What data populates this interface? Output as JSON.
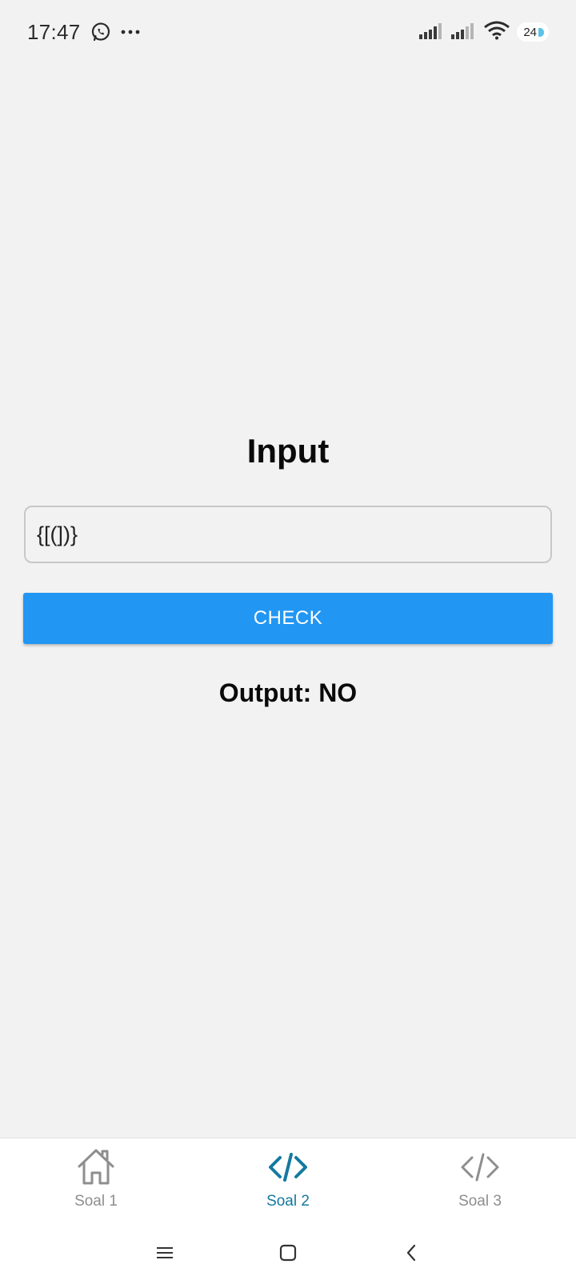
{
  "status_bar": {
    "time": "17:47",
    "battery_level": "24",
    "icons": [
      "whatsapp-icon",
      "more-dots-icon",
      "signal-icon",
      "signal-icon",
      "wifi-icon",
      "battery-icon"
    ]
  },
  "main": {
    "title": "Input",
    "input_value": "{[(])}",
    "check_label": "CHECK",
    "output_text": "Output: NO"
  },
  "tabs": [
    {
      "label": "Soal 1",
      "icon": "home-icon",
      "active": false
    },
    {
      "label": "Soal 2",
      "icon": "code-icon",
      "active": true
    },
    {
      "label": "Soal 3",
      "icon": "code-icon",
      "active": false
    }
  ],
  "colors": {
    "accent": "#2196f3",
    "active_tab": "#1479a0",
    "inactive_tab": "#8e8e8e",
    "background": "#f2f2f2"
  },
  "system_nav": [
    "menu-icon",
    "home-square-icon",
    "back-icon"
  ]
}
